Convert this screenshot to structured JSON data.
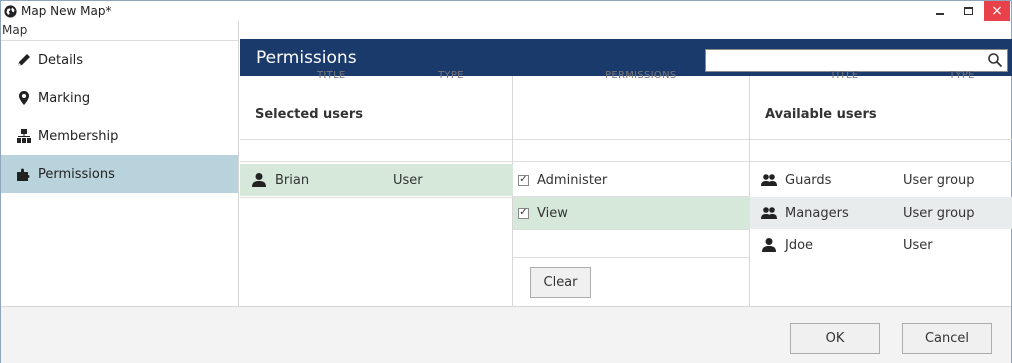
{
  "window": {
    "title": "Map New Map*",
    "close_glyph": "×"
  },
  "sidebar": {
    "header": "Map",
    "items": [
      {
        "label": "Details",
        "icon": "pencil-icon"
      },
      {
        "label": "Marking",
        "icon": "map-marker-icon"
      },
      {
        "label": "Membership",
        "icon": "hierarchy-icon"
      },
      {
        "label": "Permissions",
        "icon": "puzzle-icon",
        "active": true
      }
    ]
  },
  "main": {
    "title": "Permissions",
    "search": {
      "value": "",
      "placeholder": ""
    }
  },
  "selected_users": {
    "heading": "Selected users",
    "columns": [
      "TITLE",
      "TYPE"
    ],
    "rows": [
      {
        "title": "Brian",
        "type": "User",
        "selected": true
      }
    ]
  },
  "permissions": {
    "column": "PERMISSIONS",
    "items": [
      {
        "label": "Administer",
        "checked": true
      },
      {
        "label": "View",
        "checked": true,
        "selected": true
      }
    ],
    "check_glyph": "✓",
    "clear_label": "Clear"
  },
  "available_users": {
    "heading": "Available users",
    "columns": [
      "TITLE",
      "TYPE"
    ],
    "rows": [
      {
        "title": "Guards",
        "type": "User group",
        "icon": "users-icon"
      },
      {
        "title": "Managers",
        "type": "User group",
        "icon": "users-icon",
        "highlighted": true
      },
      {
        "title": "Jdoe",
        "type": "User",
        "icon": "user-icon"
      }
    ]
  },
  "footer": {
    "ok_label": "OK",
    "cancel_label": "Cancel"
  },
  "colors": {
    "header_bg": "#1a3a6b",
    "active_nav_bg": "#b9d3dc",
    "selected_row_bg": "#d5e8da",
    "close_bg": "#e8414a"
  }
}
